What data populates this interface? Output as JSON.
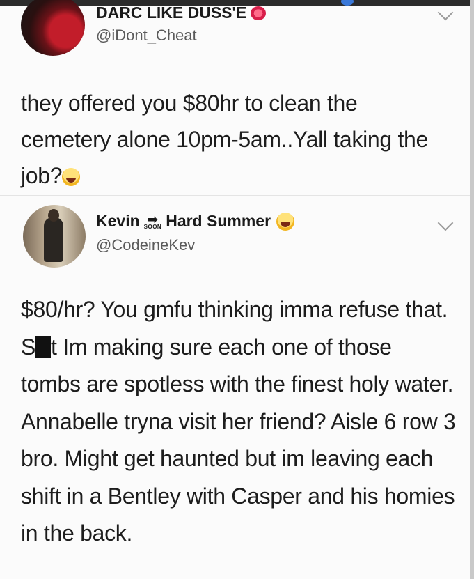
{
  "tweets": [
    {
      "display_name": "DARC LIKE DUSS'E",
      "name_emoji": "lips",
      "handle": "@iDont_Cheat",
      "text": "they offered you $80hr to clean the cemetery alone 10pm-5am..Yall taking the job?",
      "trailing_emoji": "laughing-tears"
    },
    {
      "display_name_part1": "Kevin",
      "soon_arrow": "➡",
      "soon_label": "SOON",
      "display_name_part2": "Hard Summer",
      "name_emoji": "grinning-sweat",
      "handle": "@CodeineKev",
      "text_part1": "$80/hr? You gmfu thinking imma refuse that. S",
      "censored": true,
      "text_part2": "t Im making sure each one of those tombs are spotless with the finest holy water. Annabelle tryna visit her friend? Aisle 6 row 3 bro. Might get haunted but im leaving each shift in a Bentley with Casper and his homies in the back."
    }
  ],
  "icons": {
    "menu": "chevron-down-icon"
  },
  "colors": {
    "background": "#fbfbfb",
    "text": "#1d1d1d",
    "handle": "#5a5a5a"
  }
}
